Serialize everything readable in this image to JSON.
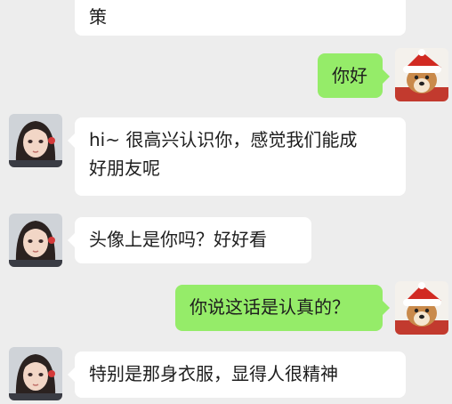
{
  "messages": [
    {
      "sender": "other",
      "text": "策"
    },
    {
      "sender": "me",
      "text": "你好"
    },
    {
      "sender": "other",
      "text": "hi~ 很高兴认识你，感觉我们能成\n好朋友呢"
    },
    {
      "sender": "other",
      "text": "头像上是你吗？好好看"
    },
    {
      "sender": "me",
      "text": "你说这话是认真的？"
    },
    {
      "sender": "other",
      "text": "特别是那身衣服，显得人很精神"
    }
  ],
  "avatars": {
    "other": "anime-girl-avatar",
    "me": "dog-in-santa-hat-avatar"
  },
  "colors": {
    "background": "#ededed",
    "incoming_bubble": "#ffffff",
    "outgoing_bubble": "#95ec69",
    "text": "#1d1d1d"
  }
}
